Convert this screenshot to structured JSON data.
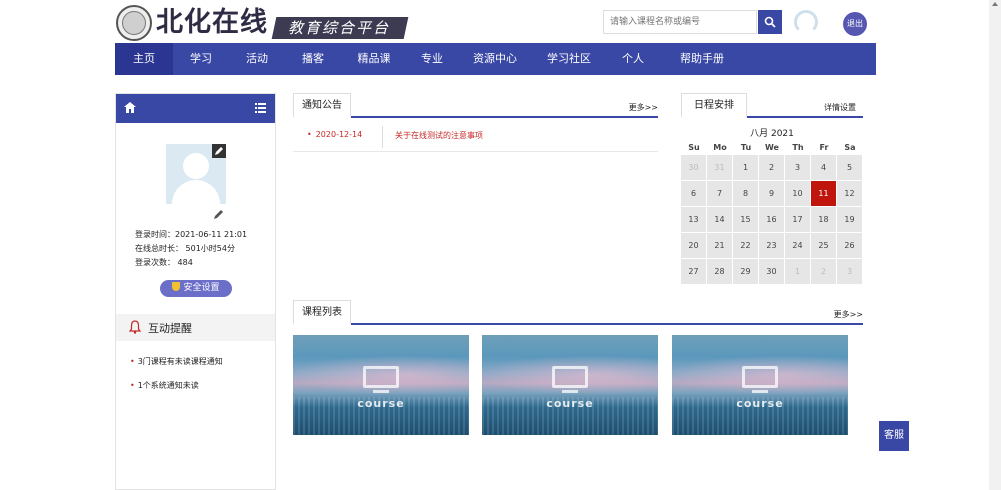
{
  "header": {
    "brand": "北化在线",
    "tagline": "教育综合平台",
    "search_placeholder": "请输入课程名称或编号",
    "logout": "退出"
  },
  "nav": {
    "items": [
      {
        "label": "主页",
        "active": true
      },
      {
        "label": "学习"
      },
      {
        "label": "活动"
      },
      {
        "label": "播客"
      },
      {
        "label": "精品课"
      },
      {
        "label": "专业"
      },
      {
        "label": "资源中心"
      },
      {
        "label": "学习社区"
      },
      {
        "label": "个人"
      },
      {
        "label": "帮助手册"
      }
    ]
  },
  "sidebar": {
    "login_time": "登录时间：2021-06-11 21:01",
    "online_total": "在线总时长：  501小时54分",
    "login_count": "登录次数：  484",
    "security_button": "安全设置",
    "remind_title": "互动提醒",
    "reminders": [
      "3门课程有未读课程通知",
      "1个系统通知未读"
    ]
  },
  "notice": {
    "tab": "通知公告",
    "more": "更多>>",
    "items": [
      {
        "date": "2020-12-14",
        "title": "关于在线测试的注意事项"
      }
    ]
  },
  "schedule": {
    "tab": "日程安排",
    "settings": "详情设置",
    "month": "八月 2021",
    "weekdays": [
      "Su",
      "Mo",
      "Tu",
      "We",
      "Th",
      "Fr",
      "Sa"
    ],
    "weeks": [
      [
        {
          "d": "30",
          "o": true
        },
        {
          "d": "31",
          "o": true
        },
        {
          "d": "1"
        },
        {
          "d": "2"
        },
        {
          "d": "3"
        },
        {
          "d": "4"
        },
        {
          "d": "5"
        }
      ],
      [
        {
          "d": "6"
        },
        {
          "d": "7"
        },
        {
          "d": "8"
        },
        {
          "d": "9"
        },
        {
          "d": "10"
        },
        {
          "d": "11",
          "today": true
        },
        {
          "d": "12"
        }
      ],
      [
        {
          "d": "13"
        },
        {
          "d": "14"
        },
        {
          "d": "15"
        },
        {
          "d": "16"
        },
        {
          "d": "17"
        },
        {
          "d": "18"
        },
        {
          "d": "19"
        }
      ],
      [
        {
          "d": "20"
        },
        {
          "d": "21"
        },
        {
          "d": "22"
        },
        {
          "d": "23"
        },
        {
          "d": "24"
        },
        {
          "d": "25"
        },
        {
          "d": "26"
        }
      ],
      [
        {
          "d": "27"
        },
        {
          "d": "28"
        },
        {
          "d": "29"
        },
        {
          "d": "30"
        },
        {
          "d": "1",
          "o": true
        },
        {
          "d": "2",
          "o": true
        },
        {
          "d": "3",
          "o": true
        }
      ]
    ]
  },
  "courses": {
    "tab": "课程列表",
    "more": "更多>>",
    "items": [
      {
        "label": "course"
      },
      {
        "label": "course"
      },
      {
        "label": "course"
      }
    ]
  },
  "float_button": "客服",
  "colors": {
    "primary": "#3947a5",
    "accent_red": "#c0150d"
  }
}
